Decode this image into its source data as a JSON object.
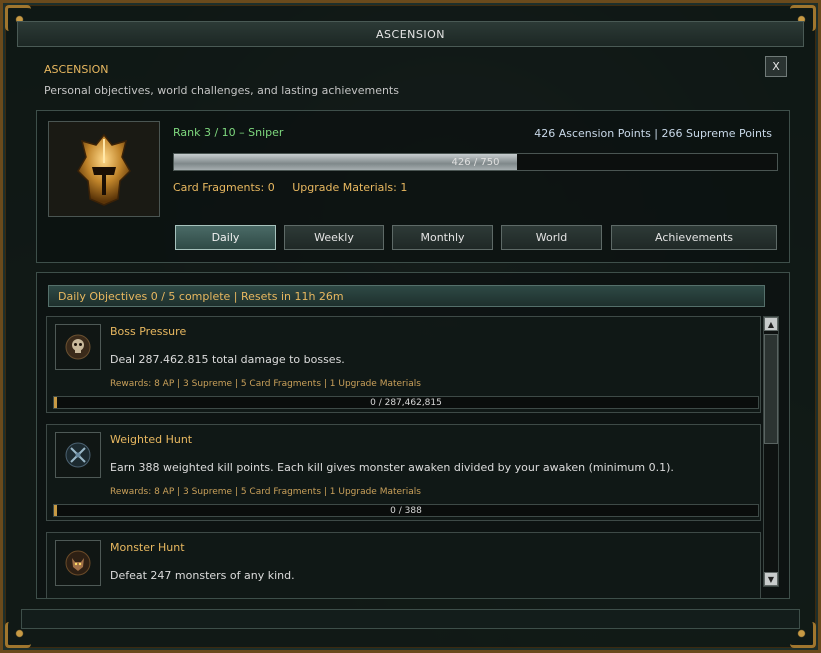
{
  "window": {
    "title": "ASCENSION",
    "close_label": "X"
  },
  "header": {
    "title": "ASCENSION",
    "subtitle": "Personal objectives, world challenges, and lasting achievements"
  },
  "profile": {
    "rank_text": "Rank 3 / 10  –  Sniper",
    "points_text": "426 Ascension Points  |  266 Supreme Points",
    "rank_progress": {
      "current": 426,
      "max": 750,
      "label": "426 / 750"
    },
    "card_fragments": "Card Fragments: 0",
    "upgrade_materials": "Upgrade Materials: 1",
    "portrait_icon": "golden-helmet-icon"
  },
  "tabs": [
    {
      "label": "Daily",
      "active": true
    },
    {
      "label": "Weekly",
      "active": false
    },
    {
      "label": "Monthly",
      "active": false
    },
    {
      "label": "World",
      "active": false
    },
    {
      "label": "Achievements",
      "active": false
    }
  ],
  "objectives_header": "Daily Objectives  0 / 5 complete  |  Resets in 11h 26m",
  "objectives": [
    {
      "name": "Boss Pressure",
      "description": "Deal 287.462.815 total damage to bosses.",
      "rewards": "Rewards: 8 AP  |  3 Supreme  |  5 Card Fragments  |  1 Upgrade Materials",
      "progress_label": "0 / 287,462,815",
      "progress": 0,
      "icon": "skull-icon"
    },
    {
      "name": "Weighted Hunt",
      "description": "Earn 388 weighted kill points. Each kill gives monster awaken divided by your awaken (minimum 0.1).",
      "rewards": "Rewards: 8 AP  |  3 Supreme  |  5 Card Fragments  |  1 Upgrade Materials",
      "progress_label": "0 / 388",
      "progress": 0,
      "icon": "crossed-swords-icon"
    },
    {
      "name": "Monster Hunt",
      "description": "Defeat 247 monsters of any kind.",
      "icon": "monster-icon"
    }
  ],
  "scrollbar": {
    "up": "▲",
    "down": "▼"
  },
  "colors": {
    "gold_text": "#e8b860",
    "rank_green": "#7ed87e",
    "frame_gold": "#a0762e",
    "active_tab": "#4a6a66"
  }
}
